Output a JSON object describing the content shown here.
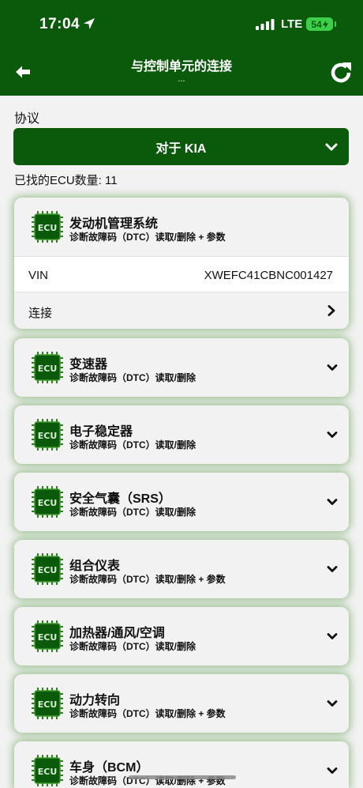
{
  "status_bar": {
    "time": "17:04",
    "network": "LTE",
    "battery": "54"
  },
  "nav": {
    "title": "与控制单元的连接",
    "subtitle": "..."
  },
  "protocol": {
    "label": "协议",
    "selected": "对于 KIA"
  },
  "ecu_count_text": "已找的ECU数量: 11",
  "ecus": [
    {
      "name": "发动机管理系统",
      "desc": "诊断故障码（DTC）读取/删除 + 参数",
      "vin_label": "VIN",
      "vin": "XWEFC41CBNC001427",
      "connect_label": "连接"
    },
    {
      "name": "变速器",
      "desc": "诊断故障码（DTC）读取/删除"
    },
    {
      "name": "电子稳定器",
      "desc": "诊断故障码（DTC）读取/删除"
    },
    {
      "name": "安全气囊（SRS）",
      "desc": "诊断故障码（DTC）读取/删除"
    },
    {
      "name": "组合仪表",
      "desc": "诊断故障码（DTC）读取/删除 + 参数"
    },
    {
      "name": "加热器/通风/空调",
      "desc": "诊断故障码（DTC）读取/删除"
    },
    {
      "name": "动力转向",
      "desc": "诊断故障码（DTC）读取/删除 + 参数"
    },
    {
      "name": "车身（BCM）",
      "desc": "诊断故障码（DTC）读取/删除 + 参数"
    }
  ],
  "icons": {
    "back": "arrow-left-icon",
    "refresh": "refresh-icon",
    "ecu": "ecu-chip-icon",
    "expand": "chevron-down-icon",
    "go": "chevron-right-icon"
  },
  "colors": {
    "primary": "#0b5a0c",
    "glow": "#5a9a3c",
    "background": "#f2f2f2"
  }
}
